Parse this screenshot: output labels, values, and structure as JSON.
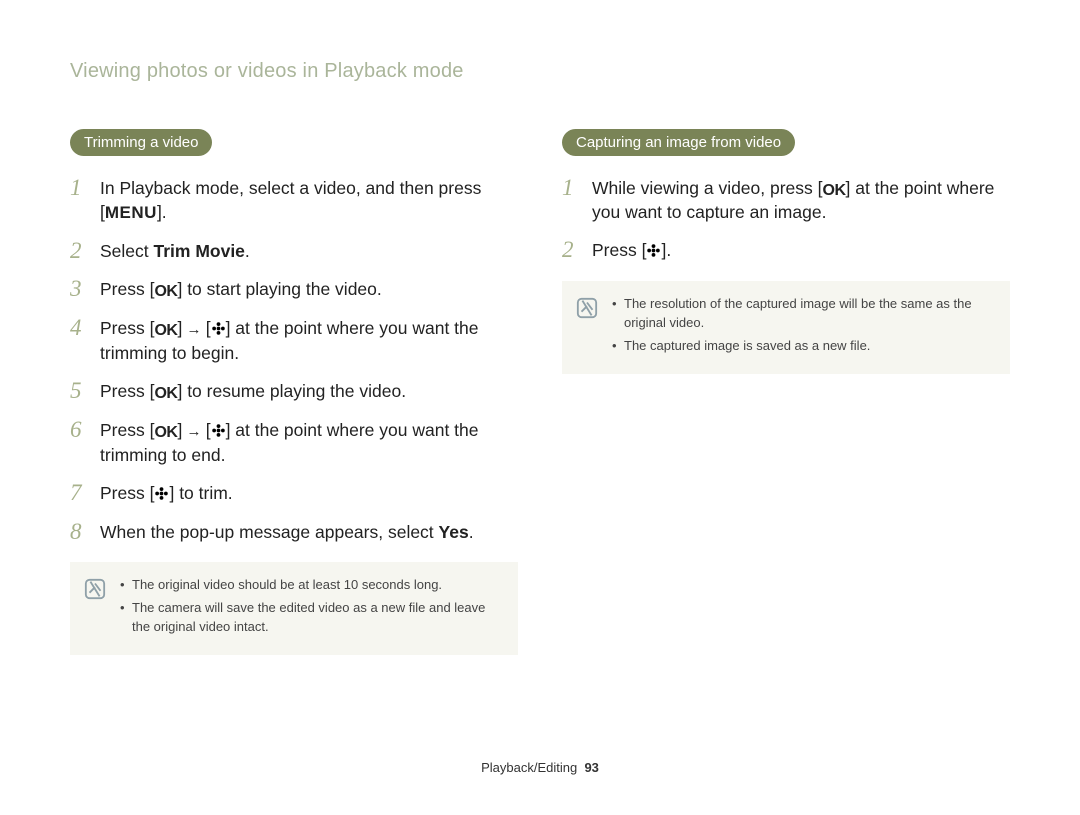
{
  "page_heading": "Viewing photos or videos in Playback mode",
  "left": {
    "pill": "Trimming a video",
    "steps": [
      {
        "pre": "In Playback mode, select a video, and then press [",
        "menu": "MENU",
        "post": "]."
      },
      {
        "pre": "Select ",
        "bold": "Trim Movie",
        "post": "."
      },
      {
        "pre": "Press [",
        "ok": true,
        "post": "] to start playing the video."
      },
      {
        "pre": "Press [",
        "ok": true,
        "arrow": " → ",
        "flower": true,
        "post2": "] at the point where you want the trimming to begin."
      },
      {
        "pre": "Press [",
        "ok": true,
        "post": "] to resume playing the video."
      },
      {
        "pre": "Press [",
        "ok": true,
        "arrow": " → ",
        "flower": true,
        "post2": "] at the point where you want the trimming to end."
      },
      {
        "pre": "Press [",
        "flower": true,
        "post": "] to trim."
      },
      {
        "pre": "When the pop-up message appears, select ",
        "bold": "Yes",
        "post": "."
      }
    ],
    "notes": [
      "The original video should be at least 10 seconds long.",
      "The camera will save the edited video as a new file and leave the original video intact."
    ]
  },
  "right": {
    "pill": "Capturing an image from video",
    "steps": [
      {
        "pre": "While viewing a video, press [",
        "ok": true,
        "post": "] at the point where you want to capture an image."
      },
      {
        "pre": "Press [",
        "flower": true,
        "post": "]."
      }
    ],
    "notes": [
      "The resolution of the captured image will be the same as the original video.",
      "The captured image is saved as a new file."
    ]
  },
  "footer_label": "Playback/Editing",
  "page_number": "93",
  "icons": {
    "ok_text": "OK"
  }
}
